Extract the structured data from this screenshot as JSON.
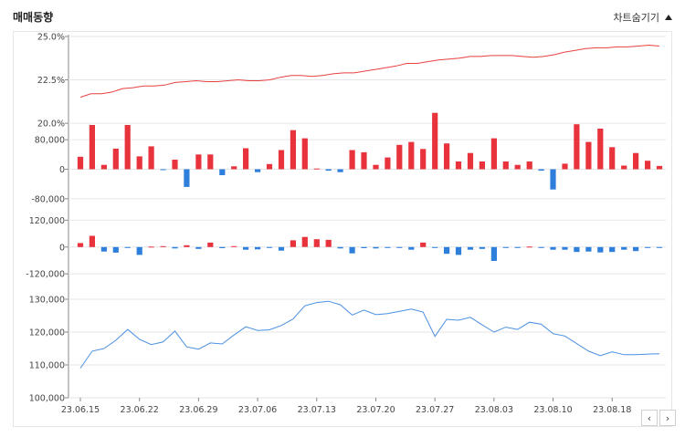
{
  "header": {
    "title": "매매동향",
    "toggle_label": "차트숨기기"
  },
  "nav": {
    "prev_icon": "‹",
    "next_icon": "›"
  },
  "colors": {
    "price_line": "#e8423f",
    "positive_bar": "#e8323c",
    "negative_bar": "#2e7fdc",
    "cumulative_line": "#4a90e2",
    "grid": "#e6e6e6",
    "axis": "#888888"
  },
  "chart_data": [
    {
      "type": "line",
      "panel": "price",
      "ylim": [
        19.9,
        25.0
      ],
      "y_ticks": [
        "25.0%",
        "22.5%",
        "20.0%"
      ],
      "y_tick_values": [
        25.0,
        22.5,
        20.0
      ],
      "values": [
        21.5,
        21.7,
        21.7,
        21.8,
        22.0,
        22.05,
        22.15,
        22.15,
        22.2,
        22.35,
        22.4,
        22.45,
        22.4,
        22.4,
        22.45,
        22.5,
        22.45,
        22.45,
        22.5,
        22.65,
        22.75,
        22.75,
        22.7,
        22.75,
        22.85,
        22.9,
        22.9,
        23.0,
        23.1,
        23.2,
        23.3,
        23.45,
        23.45,
        23.55,
        23.65,
        23.7,
        23.75,
        23.85,
        23.85,
        23.9,
        23.9,
        23.9,
        23.85,
        23.8,
        23.85,
        23.95,
        24.1,
        24.2,
        24.3,
        24.35,
        24.35,
        24.4,
        24.4,
        24.45,
        24.5,
        24.45
      ]
    },
    {
      "type": "bar",
      "panel": "net_volume_1",
      "ylim": [
        -120000,
        120000
      ],
      "y_ticks": [
        "80,000",
        "0",
        "-80,000"
      ],
      "y_tick_values": [
        80000,
        0,
        -80000
      ],
      "values": [
        34000,
        120000,
        12000,
        56000,
        120000,
        35000,
        62000,
        -2000,
        26000,
        -48000,
        40000,
        40000,
        -16000,
        8000,
        57000,
        -8000,
        14000,
        52000,
        106000,
        84000,
        2000,
        -4000,
        -8000,
        52000,
        46000,
        12000,
        32000,
        66000,
        74000,
        55000,
        153000,
        70000,
        21000,
        44000,
        21000,
        84000,
        21000,
        12000,
        21000,
        -4000,
        -55000,
        15000,
        122000,
        74000,
        110000,
        60000,
        10000,
        44000,
        23000,
        9000
      ]
    },
    {
      "type": "bar",
      "panel": "net_volume_2",
      "ylim": [
        -160000,
        150000
      ],
      "y_ticks": [
        "120,000",
        "0",
        "-120,000"
      ],
      "y_tick_values": [
        120000,
        0,
        -120000
      ],
      "values": [
        18000,
        50000,
        -20000,
        -25000,
        -3000,
        -35000,
        2000,
        4000,
        -6000,
        8000,
        -8000,
        20000,
        -5000,
        4000,
        -12000,
        -10000,
        -2000,
        -16000,
        30000,
        45000,
        35000,
        32000,
        -6000,
        -28000,
        -5000,
        -6000,
        -4000,
        -2000,
        -12000,
        20000,
        -2000,
        -30000,
        -35000,
        -12000,
        -8000,
        -62000,
        -2000,
        -4000,
        2000,
        -3000,
        -12000,
        -12000,
        -22000,
        -20000,
        -24000,
        -22000,
        -12000,
        -18000,
        -4000,
        -2000
      ]
    },
    {
      "type": "line",
      "panel": "cumulative",
      "ylim": [
        100000,
        135000
      ],
      "y_ticks": [
        "130,000",
        "120,000",
        "110,000",
        "100,000"
      ],
      "y_tick_values": [
        130000,
        120000,
        110000,
        100000
      ],
      "x_ticks": [
        "23.06.15",
        "23.06.22",
        "23.06.29",
        "23.07.06",
        "23.07.13",
        "23.07.20",
        "23.07.27",
        "23.08.03",
        "23.08.10",
        "23.08.18"
      ],
      "values": [
        109000,
        114200,
        115000,
        117500,
        120800,
        117800,
        116200,
        117000,
        120300,
        115500,
        114800,
        116700,
        116400,
        119100,
        121600,
        120500,
        120700,
        122000,
        124000,
        128000,
        129000,
        129400,
        128300,
        125200,
        126700,
        125300,
        125600,
        126300,
        127000,
        126100,
        118700,
        123900,
        123600,
        124500,
        122200,
        120000,
        121500,
        120800,
        123000,
        122400,
        119500,
        118800,
        116500,
        114200,
        112800,
        114000,
        113100,
        113100,
        113300,
        113400
      ]
    }
  ]
}
